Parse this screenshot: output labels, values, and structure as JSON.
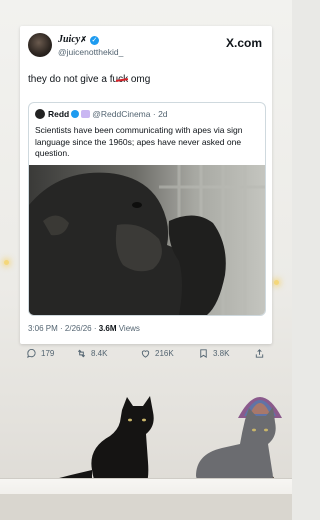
{
  "tweet": {
    "author_name": "Juicy",
    "author_handle": "@juicenotthekid_",
    "platform": "X.com",
    "text_before": "they do not give a f",
    "text_censored": "uck",
    "text_after": " omg",
    "timestamp": "3:06 PM · 2/26/26 · ",
    "views_count": "3.6M",
    "views_label": " Views",
    "replies": "179",
    "retweets": "8.4K",
    "likes": "216K",
    "bookmarks": "3.8K"
  },
  "quote": {
    "author_name": "Redd",
    "author_handle": "@ReddCinema",
    "age": "· 2d",
    "text": "Scientists  have been communicating with apes via sign language since the 1960s; apes have never asked one question."
  },
  "icons": [
    "verified-icon",
    "x-logo-icon",
    "reply-icon",
    "retweet-icon",
    "like-icon",
    "bookmark-icon",
    "share-icon"
  ],
  "colors": {
    "accent": "#1d9bf0",
    "censor": "#d8232a",
    "text": "#0f1419",
    "muted": "#536471"
  }
}
